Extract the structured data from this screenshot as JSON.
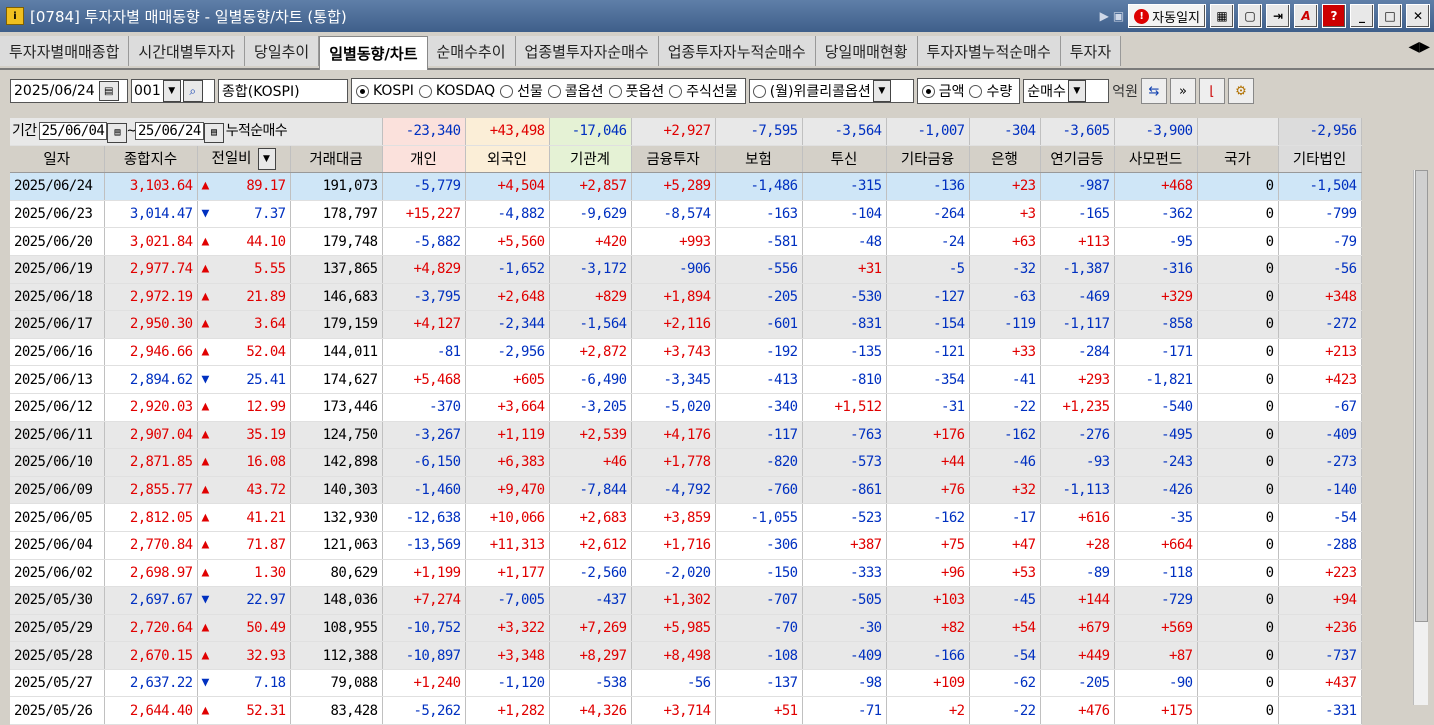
{
  "window": {
    "code": "[0784]",
    "title": "투자자별 매매동향 - 일별동향/차트 (통합)",
    "autolog_label": "자동일지"
  },
  "tabs": [
    "투자자별매매종합",
    "시간대별투자자",
    "당일추이",
    "일별동향/차트",
    "순매수추이",
    "업종별투자자순매수",
    "업종투자자누적순매수",
    "당일매매현황",
    "투자자별누적순매수",
    "투자자"
  ],
  "active_tab": 3,
  "toolbar": {
    "date": "2025/06/24",
    "code": "001",
    "market_name": "종합(KOSPI)",
    "market_options": [
      "KOSPI",
      "KOSDAQ",
      "선물",
      "콜옵션",
      "풋옵션",
      "주식선물"
    ],
    "weekly_option": "(월)위클리콜옵션",
    "unit_options": [
      "금액",
      "수량"
    ],
    "type_select": "순매수",
    "unit_label": "억원"
  },
  "period": {
    "label": "기간",
    "from": "25/06/04",
    "to": "25/06/24",
    "cum_label": "누적순매수",
    "cum_values": [
      "-23,340",
      "+43,498",
      "-17,046",
      "+2,927",
      "-7,595",
      "-3,564",
      "-1,007",
      "-304",
      "-3,605",
      "-3,900",
      "",
      "-2,956"
    ]
  },
  "columns": [
    "일자",
    "종합지수",
    "전일비",
    "거래대금",
    "개인",
    "외국인",
    "기관계",
    "금융투자",
    "보험",
    "투신",
    "기타금융",
    "은행",
    "연기금등",
    "사모펀드",
    "국가",
    "기타법인"
  ],
  "rows": [
    [
      "2025/06/24",
      "3,103.64",
      "up",
      "89.17",
      "191,073",
      "-5,779",
      "+4,504",
      "+2,857",
      "+5,289",
      "-1,486",
      "-315",
      "-136",
      "+23",
      "-987",
      "+468",
      "0",
      "-1,504"
    ],
    [
      "2025/06/23",
      "3,014.47",
      "down",
      "7.37",
      "178,797",
      "+15,227",
      "-4,882",
      "-9,629",
      "-8,574",
      "-163",
      "-104",
      "-264",
      "+3",
      "-165",
      "-362",
      "0",
      "-799"
    ],
    [
      "2025/06/20",
      "3,021.84",
      "up",
      "44.10",
      "179,748",
      "-5,882",
      "+5,560",
      "+420",
      "+993",
      "-581",
      "-48",
      "-24",
      "+63",
      "+113",
      "-95",
      "0",
      "-79"
    ],
    [
      "2025/06/19",
      "2,977.74",
      "up",
      "5.55",
      "137,865",
      "+4,829",
      "-1,652",
      "-3,172",
      "-906",
      "-556",
      "+31",
      "-5",
      "-32",
      "-1,387",
      "-316",
      "0",
      "-56"
    ],
    [
      "2025/06/18",
      "2,972.19",
      "up",
      "21.89",
      "146,683",
      "-3,795",
      "+2,648",
      "+829",
      "+1,894",
      "-205",
      "-530",
      "-127",
      "-63",
      "-469",
      "+329",
      "0",
      "+348"
    ],
    [
      "2025/06/17",
      "2,950.30",
      "up",
      "3.64",
      "179,159",
      "+4,127",
      "-2,344",
      "-1,564",
      "+2,116",
      "-601",
      "-831",
      "-154",
      "-119",
      "-1,117",
      "-858",
      "0",
      "-272"
    ],
    [
      "2025/06/16",
      "2,946.66",
      "up",
      "52.04",
      "144,011",
      "-81",
      "-2,956",
      "+2,872",
      "+3,743",
      "-192",
      "-135",
      "-121",
      "+33",
      "-284",
      "-171",
      "0",
      "+213"
    ],
    [
      "2025/06/13",
      "2,894.62",
      "down",
      "25.41",
      "174,627",
      "+5,468",
      "+605",
      "-6,490",
      "-3,345",
      "-413",
      "-810",
      "-354",
      "-41",
      "+293",
      "-1,821",
      "0",
      "+423"
    ],
    [
      "2025/06/12",
      "2,920.03",
      "up",
      "12.99",
      "173,446",
      "-370",
      "+3,664",
      "-3,205",
      "-5,020",
      "-340",
      "+1,512",
      "-31",
      "-22",
      "+1,235",
      "-540",
      "0",
      "-67"
    ],
    [
      "2025/06/11",
      "2,907.04",
      "up",
      "35.19",
      "124,750",
      "-3,267",
      "+1,119",
      "+2,539",
      "+4,176",
      "-117",
      "-763",
      "+176",
      "-162",
      "-276",
      "-495",
      "0",
      "-409"
    ],
    [
      "2025/06/10",
      "2,871.85",
      "up",
      "16.08",
      "142,898",
      "-6,150",
      "+6,383",
      "+46",
      "+1,778",
      "-820",
      "-573",
      "+44",
      "-46",
      "-93",
      "-243",
      "0",
      "-273"
    ],
    [
      "2025/06/09",
      "2,855.77",
      "up",
      "43.72",
      "140,303",
      "-1,460",
      "+9,470",
      "-7,844",
      "-4,792",
      "-760",
      "-861",
      "+76",
      "+32",
      "-1,113",
      "-426",
      "0",
      "-140"
    ],
    [
      "2025/06/05",
      "2,812.05",
      "up",
      "41.21",
      "132,930",
      "-12,638",
      "+10,066",
      "+2,683",
      "+3,859",
      "-1,055",
      "-523",
      "-162",
      "-17",
      "+616",
      "-35",
      "0",
      "-54"
    ],
    [
      "2025/06/04",
      "2,770.84",
      "up",
      "71.87",
      "121,063",
      "-13,569",
      "+11,313",
      "+2,612",
      "+1,716",
      "-306",
      "+387",
      "+75",
      "+47",
      "+28",
      "+664",
      "0",
      "-288"
    ],
    [
      "2025/06/02",
      "2,698.97",
      "up",
      "1.30",
      "80,629",
      "+1,199",
      "+1,177",
      "-2,560",
      "-2,020",
      "-150",
      "-333",
      "+96",
      "+53",
      "-89",
      "-118",
      "0",
      "+223"
    ],
    [
      "2025/05/30",
      "2,697.67",
      "down",
      "22.97",
      "148,036",
      "+7,274",
      "-7,005",
      "-437",
      "+1,302",
      "-707",
      "-505",
      "+103",
      "-45",
      "+144",
      "-729",
      "0",
      "+94"
    ],
    [
      "2025/05/29",
      "2,720.64",
      "up",
      "50.49",
      "108,955",
      "-10,752",
      "+3,322",
      "+7,269",
      "+5,985",
      "-70",
      "-30",
      "+82",
      "+54",
      "+679",
      "+569",
      "0",
      "+236"
    ],
    [
      "2025/05/28",
      "2,670.15",
      "up",
      "32.93",
      "112,388",
      "-10,897",
      "+3,348",
      "+8,297",
      "+8,498",
      "-108",
      "-409",
      "-166",
      "-54",
      "+449",
      "+87",
      "0",
      "-737"
    ],
    [
      "2025/05/27",
      "2,637.22",
      "down",
      "7.18",
      "79,088",
      "+1,240",
      "-1,120",
      "-538",
      "-56",
      "-137",
      "-98",
      "+109",
      "-62",
      "-205",
      "-90",
      "0",
      "+437"
    ],
    [
      "2025/05/26",
      "2,644.40",
      "up",
      "52.31",
      "83,428",
      "-5,262",
      "+1,282",
      "+4,326",
      "+3,714",
      "+51",
      "-71",
      "+2",
      "-22",
      "+476",
      "+175",
      "0",
      "-331"
    ]
  ],
  "row_groups": [
    "sel",
    "white",
    "white",
    "gray",
    "gray",
    "gray",
    "white",
    "white",
    "white",
    "gray",
    "gray",
    "gray",
    "white",
    "white",
    "white",
    "gray",
    "gray",
    "gray",
    "white",
    "white"
  ]
}
